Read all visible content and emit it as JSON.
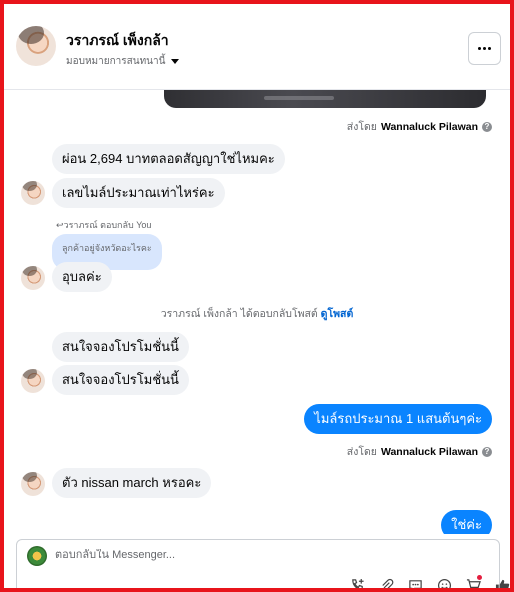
{
  "header": {
    "contact_name": "วราภรณ์ เพ็งกล้า",
    "assign_label": "มอบหมายการสนทนานี้",
    "menu_label": "···"
  },
  "messages": {
    "sent_by_1": {
      "prefix": "ส่งโดย",
      "name": "Wannaluck Pilawan",
      "info": "?"
    },
    "in_1": "ผ่อน 2,694 บาทตลอดสัญญาใช่ไหมคะ",
    "in_2": "เลขไมล์ประมาณเท่าไหร่คะ",
    "reply_label": "↩วราภรณ์ ตอบกลับ You",
    "reply_quote": "ลูกค้าอยู่จังหวัดอะไรคะ",
    "in_3": "อุบลค่ะ",
    "system": {
      "text": "วราภรณ์ เพ็งกล้า ได้ตอบกลับโพสต์",
      "link": "ดูโพสต์"
    },
    "in_4": "สนใจจองโปรโมชั่นนี้",
    "in_5": "สนใจจองโปรโมชั่นนี้",
    "out_1": "ไมล์รถประมาณ 1 แสนต้นๆค่ะ",
    "sent_by_2": {
      "prefix": "ส่งโดย",
      "name": "Wannaluck Pilawan",
      "info": "?"
    },
    "in_6": "ตัว nissan march หรอคะ",
    "out_2": "ใช่ค่ะ"
  },
  "composer": {
    "placeholder": "ตอบกลับใน Messenger..."
  },
  "icons": [
    "call-add-icon",
    "attachment-icon",
    "saved-reply-icon",
    "emoji-icon",
    "cart-icon",
    "thumbs-up-icon"
  ],
  "colors": {
    "outgoing_bubble": "#0a84ff",
    "incoming_bubble": "#f0f2f5",
    "link": "#0064d1",
    "frame_border": "#e8141b"
  }
}
